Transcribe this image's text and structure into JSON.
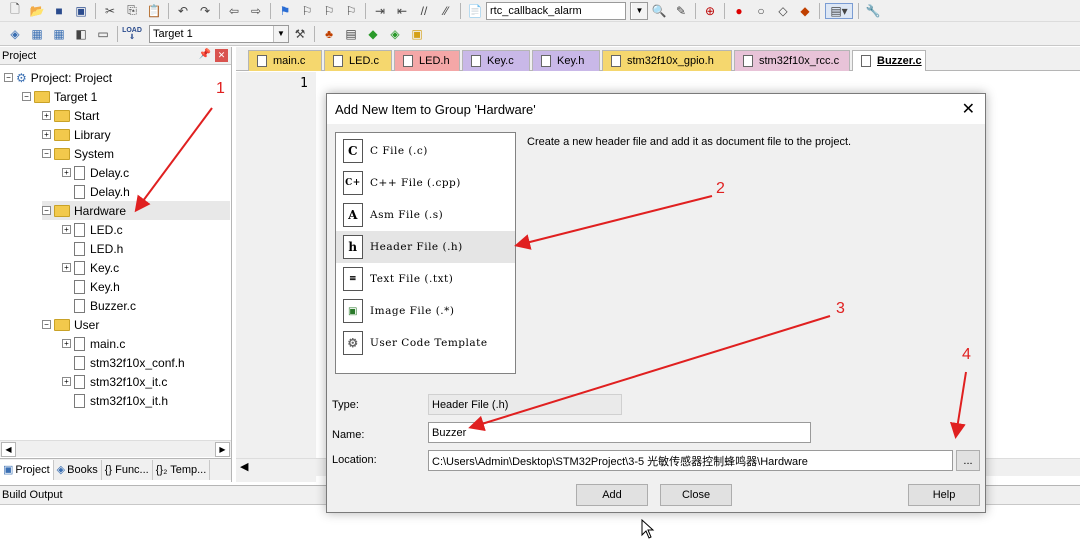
{
  "toolbar1": {
    "icons": [
      "new-file-icon",
      "open-folder-icon",
      "save-icon",
      "save-all-icon",
      "cut-icon",
      "copy-icon",
      "paste-icon",
      "undo-icon",
      "redo-icon",
      "nav-back-icon",
      "nav-forward-icon",
      "bookmark-icon",
      "bookmark-prev-icon",
      "bookmark-next-icon",
      "bookmark-clear-icon",
      "indent-icon",
      "unindent-icon",
      "comment-icon",
      "uncomment-icon",
      "find-in-files-icon"
    ],
    "find_combo": "rtc_callback_alarm"
  },
  "toolbar2": {
    "target_combo": "Target 1",
    "load_label": "LOAD"
  },
  "project_panel": {
    "title": "Project",
    "tree": [
      {
        "label": "Project: Project",
        "kind": "root"
      },
      {
        "label": "Target 1",
        "kind": "target"
      },
      {
        "label": "Start",
        "kind": "folder"
      },
      {
        "label": "Library",
        "kind": "folder"
      },
      {
        "label": "System",
        "kind": "folder"
      },
      {
        "label": "Delay.c",
        "kind": "file"
      },
      {
        "label": "Delay.h",
        "kind": "file"
      },
      {
        "label": "Hardware",
        "kind": "folder"
      },
      {
        "label": "LED.c",
        "kind": "file"
      },
      {
        "label": "LED.h",
        "kind": "file"
      },
      {
        "label": "Key.c",
        "kind": "file"
      },
      {
        "label": "Key.h",
        "kind": "file"
      },
      {
        "label": "Buzzer.c",
        "kind": "file"
      },
      {
        "label": "User",
        "kind": "folder"
      },
      {
        "label": "main.c",
        "kind": "file"
      },
      {
        "label": "stm32f10x_conf.h",
        "kind": "file"
      },
      {
        "label": "stm32f10x_it.c",
        "kind": "file"
      },
      {
        "label": "stm32f10x_it.h",
        "kind": "file"
      }
    ],
    "bottom_tabs": [
      "Project",
      "Books",
      "{} Func...",
      "{}₂ Temp..."
    ]
  },
  "file_tabs": [
    {
      "label": "main.c",
      "color": "#f5d76e"
    },
    {
      "label": "LED.c",
      "color": "#f5d76e"
    },
    {
      "label": "LED.h",
      "color": "#f4a7a7"
    },
    {
      "label": "Key.c",
      "color": "#c9b8e8"
    },
    {
      "label": "Key.h",
      "color": "#c9b8e8"
    },
    {
      "label": "stm32f10x_gpio.h",
      "color": "#f5d76e"
    },
    {
      "label": "stm32f10x_rcc.c",
      "color": "#e8c3d8"
    },
    {
      "label": "Buzzer.c",
      "color": "#ffffff"
    }
  ],
  "editor": {
    "line_number": "1"
  },
  "build_output": {
    "title": "Build Output"
  },
  "dialog": {
    "title": "Add New Item to Group 'Hardware'",
    "close_glyph": "✕",
    "items": [
      {
        "icon": "C",
        "label": "C File (.c)"
      },
      {
        "icon": "C+",
        "label": "C++ File (.cpp)"
      },
      {
        "icon": "A",
        "label": "Asm File (.s)"
      },
      {
        "icon": "h",
        "label": "Header File (.h)"
      },
      {
        "icon": "txt",
        "label": "Text File (.txt)"
      },
      {
        "icon": "img",
        "label": "Image File (.*)"
      },
      {
        "icon": "tpl",
        "label": "User Code Template"
      }
    ],
    "description": "Create a new header file and add it as document file to the project.",
    "type_label": "Type:",
    "type_value": "Header File (.h)",
    "name_label": "Name:",
    "name_value": "Buzzer",
    "location_label": "Location:",
    "location_value": "C:\\Users\\Admin\\Desktop\\STM32Project\\3-5 光敏传感器控制蜂鸣器\\Hardware",
    "browse_label": "...",
    "add_label": "Add",
    "close_label": "Close",
    "help_label": "Help"
  },
  "annotations": [
    "1",
    "2",
    "3",
    "4"
  ],
  "accent_color": "#e02020"
}
